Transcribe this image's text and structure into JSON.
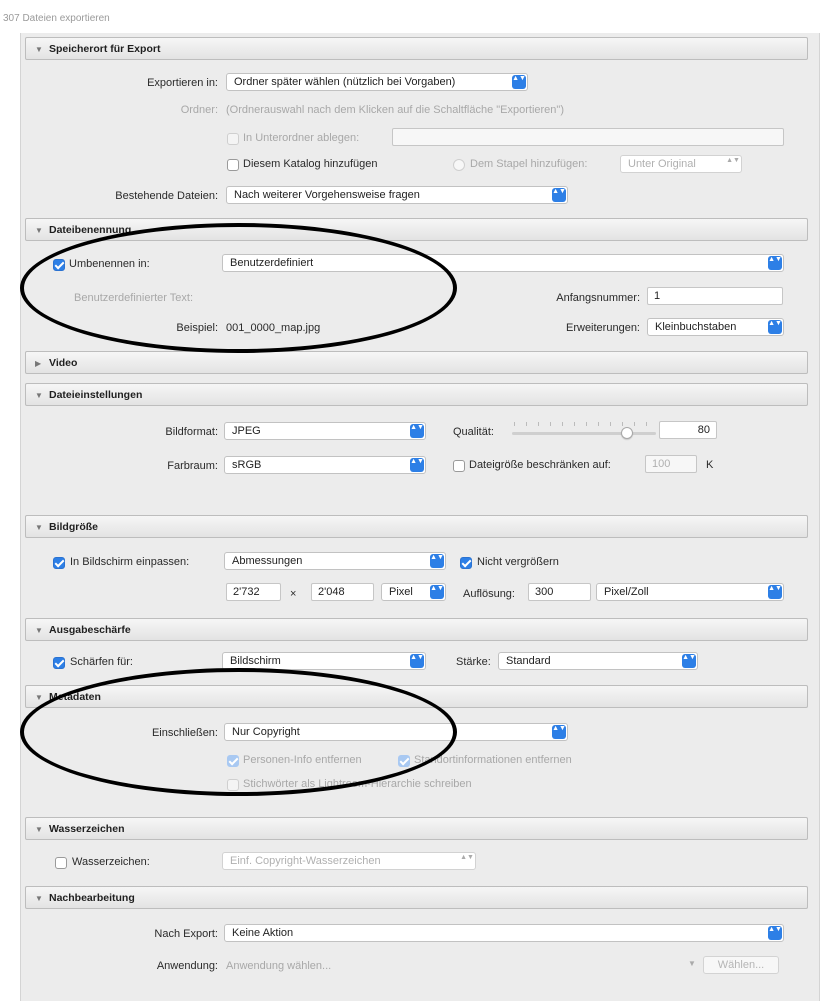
{
  "window": {
    "title": "307 Dateien exportieren"
  },
  "sections": {
    "speicherort": {
      "title": "Speicherort für Export",
      "export_in_label": "Exportieren in:",
      "export_in_value": "Ordner später wählen (nützlich bei Vorgaben)",
      "ordner_label": "Ordner:",
      "ordner_value": "(Ordnerauswahl nach dem Klicken auf die Schaltfläche \"Exportieren\")",
      "unterordner_label": "In Unterordner ablegen:",
      "katalog_label": "Diesem Katalog hinzufügen",
      "stapel_label": "Dem Stapel hinzufügen:",
      "stapel_value": "Unter Original",
      "bestehende_label": "Bestehende Dateien:",
      "bestehende_value": "Nach weiterer Vorgehensweise fragen"
    },
    "dateibenennung": {
      "title": "Dateibenennung",
      "umbenennen_label": "Umbenennen in:",
      "umbenennen_value": "Benutzerdefiniert",
      "text_label": "Benutzerdefinierter Text:",
      "anfangsnummer_label": "Anfangsnummer:",
      "anfangsnummer_value": "1",
      "beispiel_label": "Beispiel:",
      "beispiel_value": "001_0000_map.jpg",
      "erweiterungen_label": "Erweiterungen:",
      "erweiterungen_value": "Kleinbuchstaben"
    },
    "video": {
      "title": "Video"
    },
    "dateieinstellungen": {
      "title": "Dateieinstellungen",
      "bildformat_label": "Bildformat:",
      "bildformat_value": "JPEG",
      "qualitaet_label": "Qualität:",
      "qualitaet_value": "80",
      "qualitaet_fraction": 0.8,
      "farbraum_label": "Farbraum:",
      "farbraum_value": "sRGB",
      "dateigroesse_label": "Dateigröße beschränken auf:",
      "dateigroesse_value": "100",
      "dateigroesse_unit": "K"
    },
    "bildgroesse": {
      "title": "Bildgröße",
      "einpassen_label": "In Bildschirm einpassen:",
      "einpassen_value": "Abmessungen",
      "nicht_vergroessern_label": "Nicht vergrößern",
      "breite_value": "2'732",
      "times": "×",
      "hoehe_value": "2'048",
      "einheit_value": "Pixel",
      "aufloesung_label": "Auflösung:",
      "aufloesung_value": "300",
      "aufloesung_einheit": "Pixel/Zoll"
    },
    "ausgabeschaerfe": {
      "title": "Ausgabeschärfe",
      "schaerfen_label": "Schärfen für:",
      "schaerfen_value": "Bildschirm",
      "staerke_label": "Stärke:",
      "staerke_value": "Standard"
    },
    "metadaten": {
      "title": "Metadaten",
      "einschliessen_label": "Einschließen:",
      "einschliessen_value": "Nur Copyright",
      "personen_label": "Personen-Info entfernen",
      "standort_label": "Standortinformationen entfernen",
      "stichwort_label": "Stichwörter als Lightroom-Hierarchie schreiben"
    },
    "wasserzeichen": {
      "title": "Wasserzeichen",
      "wasserzeichen_label": "Wasserzeichen:",
      "wasserzeichen_value": "Einf. Copyright-Wasserzeichen"
    },
    "nachbearbeitung": {
      "title": "Nachbearbeitung",
      "nach_export_label": "Nach Export:",
      "nach_export_value": "Keine Aktion",
      "anwendung_label": "Anwendung:",
      "anwendung_value": "Anwendung wählen...",
      "waehlen_label": "Wählen..."
    }
  },
  "colors": {
    "accent": "#2d7fe6",
    "panel": "#ececec",
    "annotation": "#000000"
  },
  "icons": {
    "expanded": "▼",
    "collapsed": "▶",
    "stepper": "▲▼",
    "dropdown_small": "▼"
  }
}
